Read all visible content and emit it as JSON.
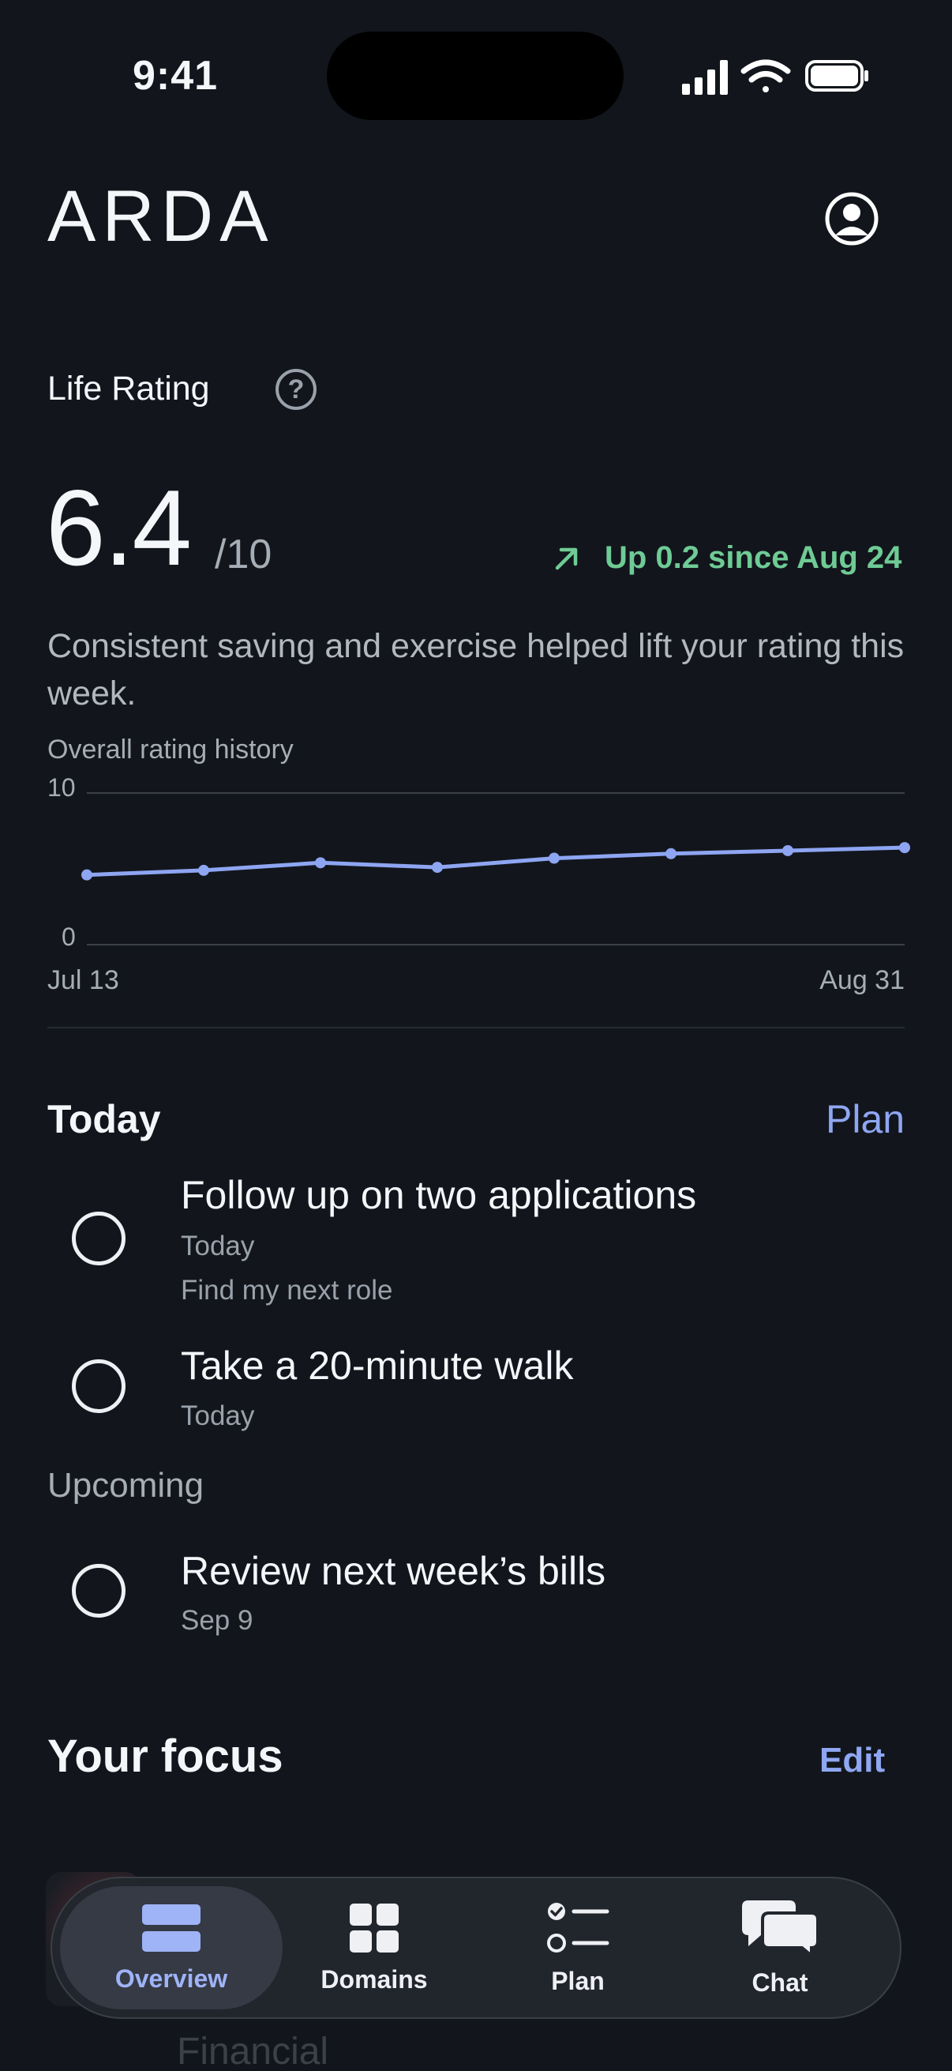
{
  "status_bar": {
    "time": "9:41"
  },
  "header": {
    "logo": "ARDA"
  },
  "life_rating": {
    "label": "Life Rating",
    "help_glyph": "?",
    "score": "6.4",
    "max": "/10",
    "trend_text": "Up 0.2 since Aug 24",
    "summary": "Consistent saving and exercise helped lift your rating this week."
  },
  "chart_data": {
    "type": "line",
    "title": "Overall rating history",
    "ylim": [
      0,
      10
    ],
    "y_ticks": [
      "10",
      "0"
    ],
    "x_labels": [
      "Jul 13",
      "Aug 31"
    ],
    "x": [
      "Jul 13",
      "Jul 20",
      "Jul 27",
      "Aug 3",
      "Aug 10",
      "Aug 17",
      "Aug 24",
      "Aug 31"
    ],
    "values": [
      4.6,
      4.9,
      5.4,
      5.1,
      5.7,
      6.0,
      6.2,
      6.4
    ],
    "series_color": "#8ea5f2",
    "grid": "horizontal at 0 and 10"
  },
  "today": {
    "title": "Today",
    "plan_label": "Plan",
    "tasks": [
      {
        "title": "Follow up on two applications",
        "due": "Today",
        "goal": "Find my next role"
      },
      {
        "title": "Take a 20-minute walk",
        "due": "Today"
      }
    ]
  },
  "upcoming": {
    "title": "Upcoming",
    "tasks": [
      {
        "title": "Review next week’s bills",
        "due": "Sep 9"
      }
    ]
  },
  "focus": {
    "title": "Your focus",
    "edit_label": "Edit",
    "obscured_item": "Financial"
  },
  "tab_bar": {
    "items": [
      {
        "label": "Overview",
        "icon": "overview-icon",
        "active": true
      },
      {
        "label": "Domains",
        "icon": "grid-icon",
        "active": false
      },
      {
        "label": "Plan",
        "icon": "checklist-icon",
        "active": false
      },
      {
        "label": "Chat",
        "icon": "chat-bubbles-icon",
        "active": false
      }
    ]
  },
  "colors": {
    "background": "#12161c",
    "accent": "#8fa6f2",
    "positive": "#6fcb95"
  }
}
